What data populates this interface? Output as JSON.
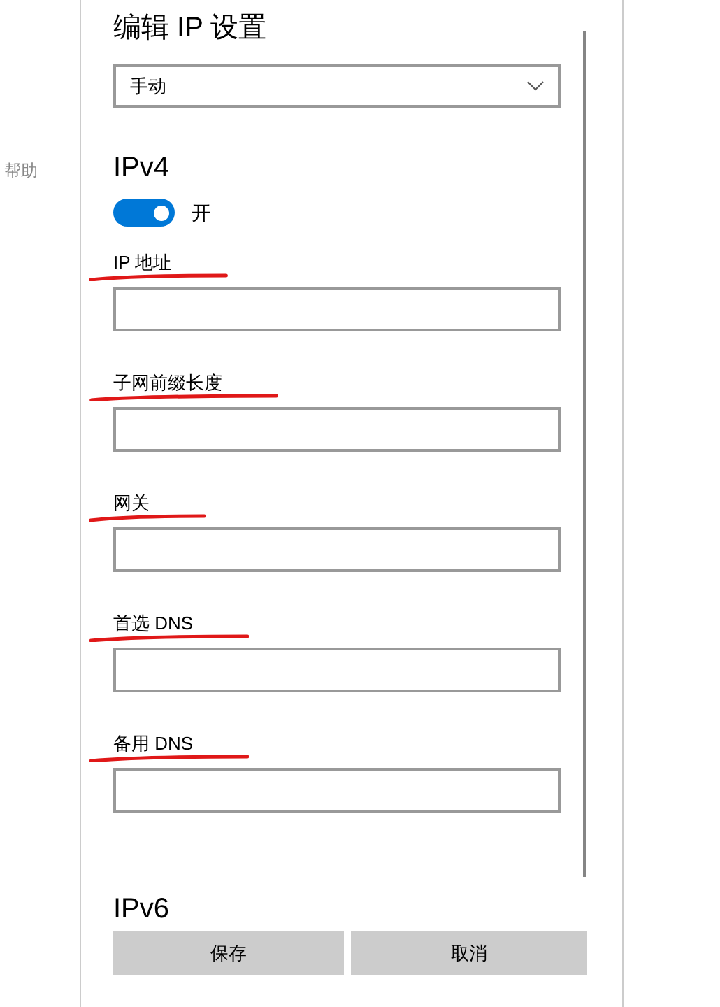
{
  "sidebar": {
    "help_link": "帮助"
  },
  "dialog": {
    "title": "编辑 IP 设置",
    "mode_dropdown": {
      "value": "手动"
    },
    "ipv4": {
      "heading": "IPv4",
      "toggle": {
        "on": true,
        "label": "开"
      },
      "fields": [
        {
          "label": "IP 地址",
          "underlined": true
        },
        {
          "label": "子网前缀长度",
          "underlined": true
        },
        {
          "label": "网关",
          "underlined": true
        },
        {
          "label": "首选 DNS",
          "underlined": true
        },
        {
          "label": "备用 DNS",
          "underlined": true
        }
      ]
    },
    "ipv6": {
      "heading": "IPv6"
    },
    "buttons": [
      {
        "label": "保存"
      },
      {
        "label": "取消"
      }
    ]
  }
}
